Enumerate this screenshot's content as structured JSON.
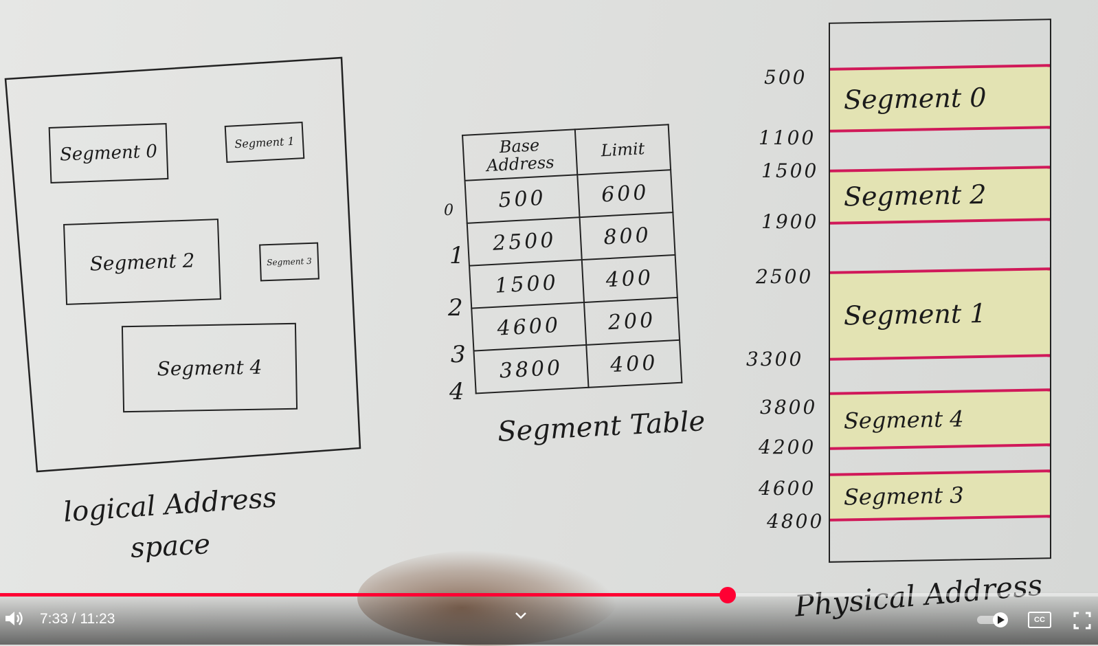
{
  "logical": {
    "segments": [
      {
        "label": "Segment 0"
      },
      {
        "label": "Segment 1"
      },
      {
        "label": "Segment 2"
      },
      {
        "label": "Segment 3"
      },
      {
        "label": "Segment 4"
      }
    ],
    "caption_line1": "logical Address",
    "caption_line2": "space"
  },
  "segment_table": {
    "header_base": "Base Address",
    "header_limit": "Limit",
    "rows": [
      {
        "index": "0",
        "base": "500",
        "limit": "600"
      },
      {
        "index": "1",
        "base": "2500",
        "limit": "800"
      },
      {
        "index": "2",
        "base": "1500",
        "limit": "400"
      },
      {
        "index": "3",
        "base": "4600",
        "limit": "200"
      },
      {
        "index": "4",
        "base": "3800",
        "limit": "400"
      }
    ],
    "caption": "Segment Table"
  },
  "physical": {
    "addresses": [
      "500",
      "1100",
      "1500",
      "1900",
      "2500",
      "3300",
      "3800",
      "4200",
      "4600",
      "4800"
    ],
    "blocks": [
      {
        "label": "Segment 0"
      },
      {
        "label": "Segment 2"
      },
      {
        "label": "Segment 1"
      },
      {
        "label": "Segment 4"
      },
      {
        "label": "Segment 3"
      }
    ],
    "caption": "Physical Address"
  },
  "player": {
    "time_display": "7:33 / 11:23",
    "progress_fraction": 0.6625,
    "accent_color": "#ff0033",
    "icons": [
      "volume-icon",
      "chevron-down-icon",
      "autoplay-toggle-icon",
      "captions-icon",
      "fullscreen-icon"
    ],
    "captions_label": "CC"
  }
}
